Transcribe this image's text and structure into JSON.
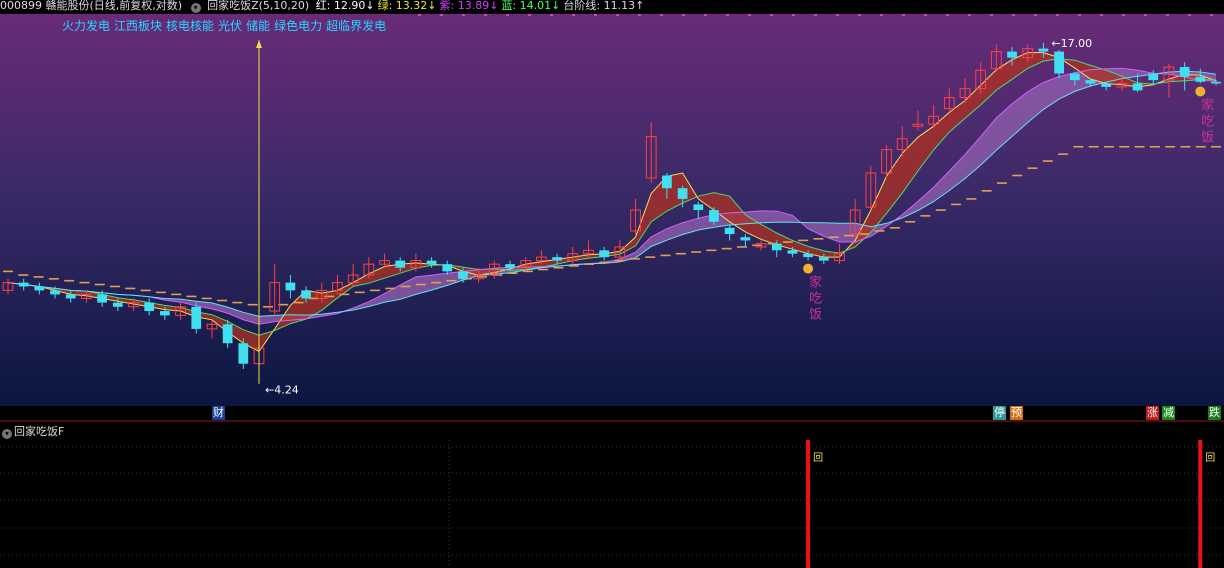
{
  "header": {
    "stock": "000899 赣能股份(日线,前复权,对数)",
    "indicator": "回家吃饭Z(5,10,20)",
    "values": [
      {
        "label": "红: 12.90↓",
        "color": "#ffffff"
      },
      {
        "label": "绿: 13.32↓",
        "color": "#e8e832"
      },
      {
        "label": "紫: 13.89↓",
        "color": "#d040ff"
      },
      {
        "label": "蓝: 14.01↓",
        "color": "#40ff60"
      },
      {
        "label": "台阶线: 11.13↑",
        "color": "#dddddd"
      }
    ]
  },
  "sectors": [
    "火力发电",
    "江西板块",
    "核电核能",
    "光伏",
    "储能",
    "绿色电力",
    "超临界发电"
  ],
  "chart_data": {
    "type": "candlestick",
    "high_label": "17.00",
    "low_label": "4.24",
    "signal_text": [
      "家",
      "吃",
      "饭"
    ],
    "bottom_tags": [
      {
        "text": "财",
        "color": "#1a3f9a"
      },
      {
        "text": "停",
        "color": "#2a9a9a"
      },
      {
        "text": "预",
        "color": "#d07010"
      },
      {
        "text": "涨",
        "color": "#c01a1a"
      },
      {
        "text": "减",
        "color": "#1a8a1a"
      },
      {
        "text": "跌",
        "color": "#1a7a1a"
      }
    ],
    "candles": [
      [
        6.2,
        6.4,
        6.5,
        6.1
      ],
      [
        6.4,
        6.3,
        6.5,
        6.2
      ],
      [
        6.3,
        6.2,
        6.4,
        6.1
      ],
      [
        6.2,
        6.1,
        6.3,
        6.0
      ],
      [
        6.1,
        6.0,
        6.2,
        5.9
      ],
      [
        6.0,
        6.1,
        6.2,
        5.9
      ],
      [
        6.1,
        5.9,
        6.2,
        5.8
      ],
      [
        5.9,
        5.8,
        6.0,
        5.7
      ],
      [
        5.8,
        5.9,
        6.0,
        5.7
      ],
      [
        5.9,
        5.7,
        6.0,
        5.6
      ],
      [
        5.7,
        5.6,
        5.8,
        5.5
      ],
      [
        5.6,
        5.8,
        5.9,
        5.5
      ],
      [
        5.8,
        5.3,
        5.9,
        5.2
      ],
      [
        5.3,
        5.4,
        5.5,
        5.1
      ],
      [
        5.4,
        5.0,
        5.5,
        4.9
      ],
      [
        5.0,
        4.6,
        5.1,
        4.5
      ],
      [
        4.6,
        4.9,
        5.2,
        4.24
      ],
      [
        5.7,
        6.4,
        6.9,
        5.6
      ],
      [
        6.4,
        6.2,
        6.6,
        6.0
      ],
      [
        6.2,
        6.0,
        6.3,
        5.9
      ],
      [
        6.0,
        6.2,
        6.4,
        5.9
      ],
      [
        6.2,
        6.4,
        6.6,
        6.1
      ],
      [
        6.4,
        6.6,
        6.9,
        6.3
      ],
      [
        6.6,
        6.9,
        7.1,
        6.5
      ],
      [
        6.9,
        7.0,
        7.2,
        6.8
      ],
      [
        7.0,
        6.8,
        7.1,
        6.7
      ],
      [
        6.8,
        7.0,
        7.2,
        6.7
      ],
      [
        7.0,
        6.9,
        7.1,
        6.8
      ],
      [
        6.9,
        6.7,
        7.0,
        6.6
      ],
      [
        6.7,
        6.5,
        6.8,
        6.4
      ],
      [
        6.5,
        6.6,
        6.8,
        6.4
      ],
      [
        6.6,
        6.9,
        7.0,
        6.5
      ],
      [
        6.9,
        6.8,
        7.0,
        6.7
      ],
      [
        6.8,
        7.0,
        7.1,
        6.7
      ],
      [
        7.0,
        7.1,
        7.3,
        6.9
      ],
      [
        7.1,
        7.0,
        7.2,
        6.9
      ],
      [
        7.0,
        7.2,
        7.4,
        6.9
      ],
      [
        7.2,
        7.3,
        7.6,
        7.1
      ],
      [
        7.3,
        7.1,
        7.4,
        7.0
      ],
      [
        7.1,
        7.4,
        7.6,
        7.0
      ],
      [
        7.9,
        8.6,
        9.0,
        7.8
      ],
      [
        9.8,
        11.6,
        12.3,
        9.6
      ],
      [
        9.9,
        9.4,
        10.0,
        9.0
      ],
      [
        9.4,
        9.0,
        9.5,
        8.7
      ],
      [
        8.8,
        8.6,
        8.9,
        8.3
      ],
      [
        8.6,
        8.2,
        8.7,
        8.1
      ],
      [
        8.0,
        7.8,
        8.1,
        7.6
      ],
      [
        7.7,
        7.6,
        7.8,
        7.4
      ],
      [
        7.4,
        7.5,
        7.6,
        7.3
      ],
      [
        7.5,
        7.3,
        7.6,
        7.1
      ],
      [
        7.3,
        7.2,
        7.4,
        7.1
      ],
      [
        7.2,
        7.1,
        7.3,
        7.0
      ],
      [
        7.1,
        7.0,
        7.2,
        6.9
      ],
      [
        7.0,
        7.2,
        7.5,
        6.9
      ],
      [
        7.8,
        8.6,
        9.0,
        7.7
      ],
      [
        8.7,
        10.0,
        10.3,
        8.6
      ],
      [
        10.0,
        11.0,
        11.2,
        9.8
      ],
      [
        11.0,
        11.5,
        12.1,
        10.7
      ],
      [
        12.1,
        12.2,
        12.9,
        11.9
      ],
      [
        12.2,
        12.6,
        13.2,
        12.0
      ],
      [
        13.0,
        13.6,
        14.1,
        12.9
      ],
      [
        13.6,
        14.1,
        14.7,
        13.3
      ],
      [
        14.1,
        15.2,
        15.7,
        13.8
      ],
      [
        15.3,
        16.4,
        16.9,
        15.1
      ],
      [
        16.4,
        16.0,
        16.7,
        15.5
      ],
      [
        16.0,
        16.6,
        16.9,
        15.7
      ],
      [
        16.6,
        16.4,
        17.0,
        16.0
      ],
      [
        16.4,
        15.0,
        16.5,
        14.7
      ],
      [
        15.0,
        14.6,
        15.1,
        14.3
      ],
      [
        14.6,
        14.4,
        14.7,
        14.2
      ],
      [
        14.4,
        14.2,
        14.5,
        14.0
      ],
      [
        14.2,
        14.4,
        14.8,
        14.0
      ],
      [
        14.4,
        14.0,
        15.0,
        13.9
      ],
      [
        15.0,
        14.6,
        15.2,
        14.3
      ],
      [
        14.6,
        15.4,
        15.6,
        13.6
      ],
      [
        15.4,
        14.8,
        15.7,
        14.0
      ],
      [
        14.8,
        14.5,
        15.3,
        14.4
      ],
      [
        14.5,
        14.4,
        14.6,
        14.3
      ]
    ],
    "step_line": [
      [
        6.7,
        6.6,
        6.55,
        6.5,
        6.45,
        6.4,
        6.35,
        6.3,
        6.25,
        6.2,
        6.15,
        6.1,
        6.05,
        6.0,
        5.95,
        5.9,
        5.85,
        5.8,
        5.85,
        5.9
      ],
      [
        6.0,
        6.05,
        6.1,
        6.15,
        6.2,
        6.25,
        6.3,
        6.35,
        6.4,
        6.45,
        6.5,
        6.55,
        6.6,
        6.65,
        6.7,
        6.75,
        6.8,
        6.85,
        6.9,
        6.95
      ],
      [
        7.0,
        7.05,
        7.1,
        7.15,
        7.2,
        7.25,
        7.3,
        7.35,
        7.4,
        7.45,
        7.5,
        7.55,
        7.6,
        7.65,
        7.7,
        7.75,
        7.8,
        7.9,
        8.0,
        8.2
      ],
      [
        8.4,
        8.6,
        8.8,
        9.0,
        9.3,
        9.6,
        9.9,
        10.2,
        10.5,
        10.8,
        11.13,
        11.13,
        11.13,
        11.13,
        11.13,
        11.13,
        11.13,
        11.13,
        11.13,
        11.13
      ]
    ]
  },
  "sub_chart": {
    "title": "回家吃饭F",
    "signal_label": "回"
  }
}
